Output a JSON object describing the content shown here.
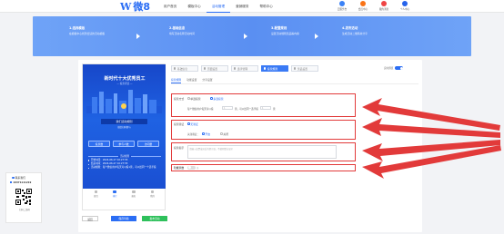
{
  "topbar": {
    "logo_w": "W",
    "logo_brand": "微8",
    "nav": [
      "用户首页",
      "模板中心",
      "活动管理",
      "营销服务",
      "帮助中心"
    ],
    "active_nav": 2,
    "icons": [
      {
        "label": "云服务台",
        "icon": "cloud-icon",
        "color": "#3b82f6"
      },
      {
        "label": "会员中心",
        "icon": "user-icon",
        "color": "#f97316"
      },
      {
        "label": "我的消息",
        "icon": "bell-icon",
        "color": "#ef4444"
      },
      {
        "label": "个人中心",
        "icon": "profile-icon",
        "color": "#2563eb"
      }
    ]
  },
  "banner": {
    "steps": [
      {
        "title": "1.选择模板",
        "desc": "在模板中心找到合适的活动模板"
      },
      {
        "title": "2.基础信息",
        "desc": "填写活动名称活动时间"
      },
      {
        "title": "3.配置规则",
        "desc": "设置活动规则奖品等内容"
      },
      {
        "title": "4.发布活动",
        "desc": "生成活动二维码并分享"
      }
    ]
  },
  "poster": {
    "title": "新时代十大优秀员工",
    "subtitle": "— 投票评选 —",
    "activity_btn": "我们活动规则",
    "activity_sub": "微信扫码参与",
    "stats_buttons": [
      "投票数",
      "参与人数",
      "访问量"
    ],
    "divider": "活动规则",
    "info": [
      "开始时间：2024-06-17 10:27:55",
      "结束时间：2024-06-27 10:27:55",
      "活动规则：每个微信用户每天可以投1票，可以给同一个选手投"
    ],
    "tabs": [
      {
        "label": "首页",
        "icon": "home-icon"
      },
      {
        "label": "排行",
        "icon": "rank-icon"
      },
      {
        "label": "报名",
        "icon": "signup-icon"
      },
      {
        "label": "我的",
        "icon": "mine-icon"
      }
    ],
    "active_tab": 1
  },
  "bottom_buttons": {
    "back": "返回",
    "save": "保存草稿",
    "publish": "发布活动"
  },
  "steptabs": [
    "基础信息",
    "页面设置",
    "选手管理",
    "投票规则",
    "奖品设置"
  ],
  "active_steptab": 3,
  "preview": {
    "label": "实时预览",
    "on": true
  },
  "subtabs": [
    "投票规则",
    "功能设置",
    "分享设置"
  ],
  "active_subtab": 0,
  "form": {
    "vote_mode_label": "投票方式",
    "vote_mode_options": [
      "单选投票",
      "多选投票"
    ],
    "vote_mode_selected": 1,
    "vote_rule_prefix": "每个微信用户每天可以投",
    "vote_rule_count": "1",
    "vote_rule_mid": "票，可以给同一选手投",
    "vote_rule_same": "1",
    "vote_rule_suffix": "票",
    "verify_label": "投票验证",
    "verify_option": "无验证",
    "verify_sub_label": "关注验证：",
    "verify_sub_options": [
      "开启",
      "关闭"
    ],
    "verify_sub_selected": 0,
    "notice_label": "投票提示",
    "notice_placeholder": "请输入投票成功后的提示语，不填则默认显示",
    "switch_label": "隐藏票数",
    "switch_value": "关"
  },
  "contact": {
    "header": "联系我们",
    "phone": "19371111219",
    "qr_caption": "扫码二维码"
  }
}
